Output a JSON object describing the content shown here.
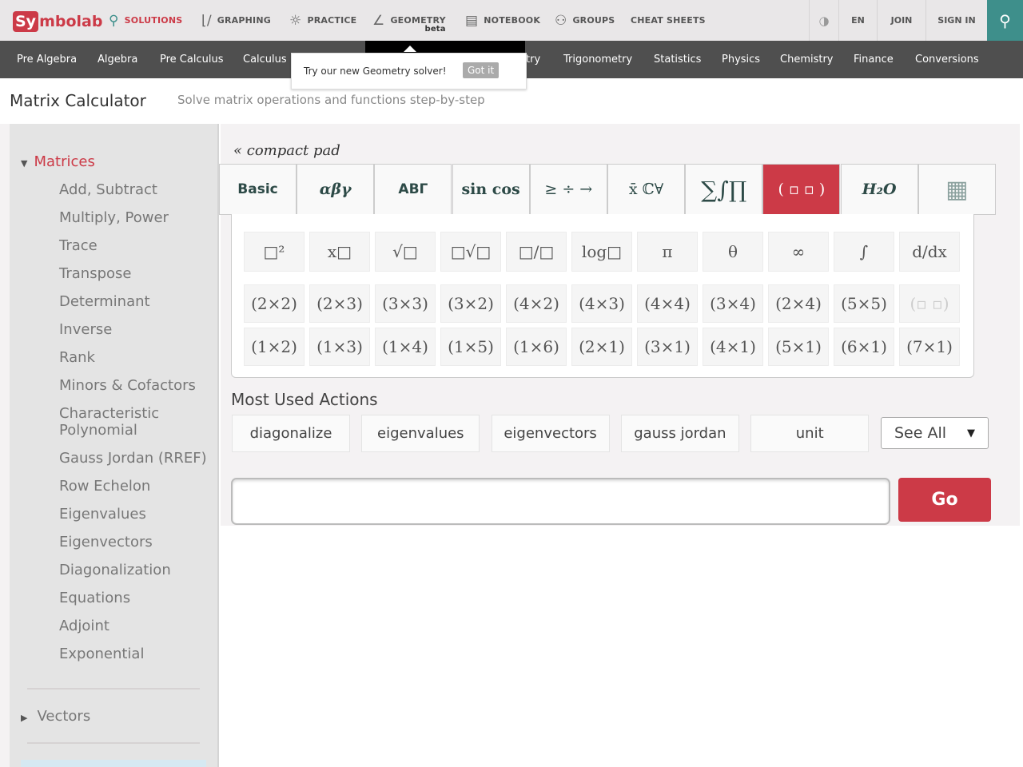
{
  "header": {
    "logo": "Symbolab",
    "logo_prefix": "Sy",
    "logo_suffix": "mbolab",
    "nav": [
      {
        "label": "SOLUTIONS",
        "icon": "search-icon"
      },
      {
        "label": "GRAPHING",
        "icon": "graph-icon"
      },
      {
        "label": "PRACTICE",
        "icon": "lightbulb-icon"
      },
      {
        "label": "GEOMETRY",
        "icon": "angle-icon",
        "badge": "beta"
      },
      {
        "label": "NOTEBOOK",
        "icon": "notebook-icon"
      },
      {
        "label": "GROUPS",
        "icon": "groups-icon"
      },
      {
        "label": "CHEAT SHEETS"
      }
    ],
    "right": {
      "lang": "EN",
      "join": "JOIN",
      "signin": "SIGN IN"
    }
  },
  "subnav": [
    "Pre Algebra",
    "Algebra",
    "Pre Calculus",
    "Calculus",
    "try",
    "Trigonometry",
    "Statistics",
    "Physics",
    "Chemistry",
    "Finance",
    "Conversions"
  ],
  "tooltip": {
    "text": "Try our new Geometry solver!",
    "button": "Got it"
  },
  "page": {
    "title": "Matrix Calculator",
    "subtitle": "Solve matrix operations and functions step-by-step"
  },
  "sidebar": {
    "section": "Matrices",
    "items": [
      "Add, Subtract",
      "Multiply, Power",
      "Trace",
      "Transpose",
      "Determinant",
      "Inverse",
      "Rank",
      "Minors & Cofactors",
      "Characteristic Polynomial",
      "Gauss Jordan (RREF)",
      "Row Echelon",
      "Eigenvalues",
      "Eigenvectors",
      "Diagonalization",
      "Equations",
      "Adjoint",
      "Exponential"
    ],
    "section2": "Vectors"
  },
  "keypad": {
    "compact": "« compact pad",
    "tabs": [
      "Basic",
      "αβγ",
      "ΑΒΓ",
      "sin cos",
      "≥ ÷ →",
      "x̄ ℂ∀",
      "∑∫∏",
      "( ▫ ▫ )",
      "H₂O",
      "calculator"
    ],
    "row1": [
      "□²",
      "x□",
      "√□",
      "□√□",
      "□/□",
      "log□",
      "π",
      "θ",
      "∞",
      "∫",
      "d/dx"
    ],
    "row2": [
      "(2×2)",
      "(2×3)",
      "(3×3)",
      "(3×2)",
      "(4×2)",
      "(4×3)",
      "(4×4)",
      "(3×4)",
      "(2×4)",
      "(5×5)",
      "(▫ ▫)"
    ],
    "row3": [
      "(1×2)",
      "(1×3)",
      "(1×4)",
      "(1×5)",
      "(1×6)",
      "(2×1)",
      "(3×1)",
      "(4×1)",
      "(5×1)",
      "(6×1)",
      "(7×1)"
    ]
  },
  "actions": {
    "title": "Most Used Actions",
    "items": [
      "diagonalize",
      "eigenvalues",
      "eigenvectors",
      "gauss jordan",
      "unit"
    ],
    "select": "See All"
  },
  "input": {
    "value": "",
    "go": "Go"
  },
  "colors": {
    "brand": "#cc3a47",
    "teal": "#3e8f8b",
    "subnav": "#4f4f4f"
  }
}
